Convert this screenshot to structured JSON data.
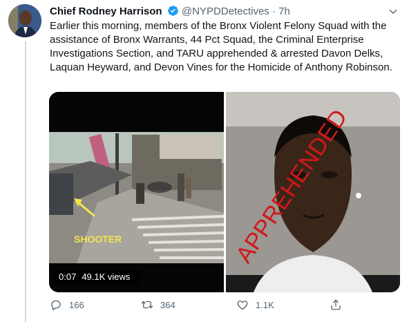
{
  "tweet": {
    "author_name": "Chief Rodney Harrison",
    "handle": "@NYPDDetectives",
    "separator": "·",
    "time": "7h",
    "text": "Earlier this morning, members of the Bronx Violent Felony Squad with the assistance of Bronx Warrants, 44 Pct Squad, the Criminal Enterprise Investigations Section, and TARU apprehended & arrested Davon Delks, Laquan Heyward, and Devon Vines for the Homicide of Anthony Robinson."
  },
  "media": {
    "video": {
      "overlay_label": "SHOOTER",
      "duration": "0:07",
      "views": "49.1K views"
    },
    "photo": {
      "stamp_text": "APPREHENDED"
    }
  },
  "actions": {
    "reply_count": "166",
    "retweet_count": "364",
    "like_count": "1.1K"
  },
  "colors": {
    "verified": "#1d9bf0",
    "muted": "#536471",
    "stamp": "#d01818",
    "shooter_label": "#f2e64b"
  },
  "icons": [
    "verified-badge-icon",
    "chevron-down-icon",
    "reply-icon",
    "retweet-icon",
    "like-icon",
    "share-icon"
  ]
}
